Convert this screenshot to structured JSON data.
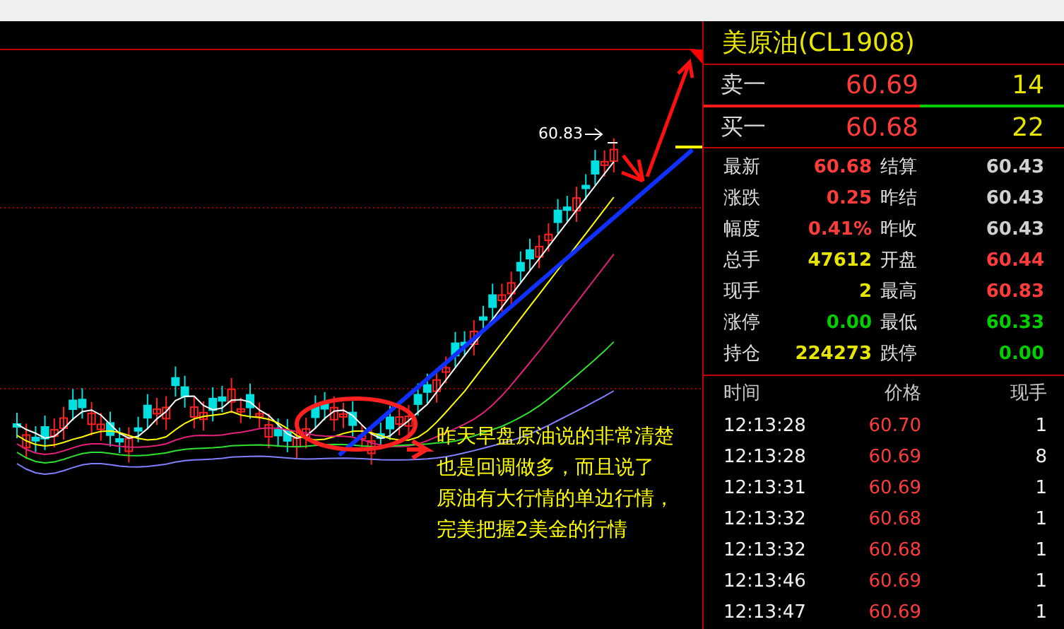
{
  "chart": {
    "high_label": "60.83",
    "annotation": [
      "昨天早盘原油说的非常清楚",
      "也是回调做多，而且说了",
      "原油有大行情的单边行情，",
      "完美把握2美金的行情"
    ]
  },
  "quote": {
    "title": "美原油(CL1908)",
    "book": [
      {
        "label": "卖一",
        "price": "60.69",
        "volume": "14"
      },
      {
        "label": "买一",
        "price": "60.68",
        "volume": "22"
      }
    ],
    "stats": [
      {
        "cells": [
          {
            "label": "最新",
            "value": "60.68",
            "color": "#ff3c3c"
          },
          {
            "label": "结算",
            "value": "60.43",
            "color": "#d0d0d0"
          }
        ]
      },
      {
        "cells": [
          {
            "label": "涨跌",
            "value": "0.25",
            "color": "#ff3c3c"
          },
          {
            "label": "昨结",
            "value": "60.43",
            "color": "#d0d0d0"
          }
        ]
      },
      {
        "cells": [
          {
            "label": "幅度",
            "value": "0.41%",
            "color": "#ff3c3c"
          },
          {
            "label": "昨收",
            "value": "60.43",
            "color": "#d0d0d0"
          }
        ]
      },
      {
        "cells": [
          {
            "label": "总手",
            "value": "47612",
            "color": "#e6e600"
          },
          {
            "label": "开盘",
            "value": "60.44",
            "color": "#ff3c3c"
          }
        ]
      },
      {
        "cells": [
          {
            "label": "现手",
            "value": "2",
            "color": "#e6e600"
          },
          {
            "label": "最高",
            "value": "60.83",
            "color": "#ff3c3c"
          }
        ]
      },
      {
        "cells": [
          {
            "label": "涨停",
            "value": "0.00",
            "color": "#00d000"
          },
          {
            "label": "最低",
            "value": "60.33",
            "color": "#00d000"
          }
        ]
      },
      {
        "cells": [
          {
            "label": "持仓",
            "value": "224273",
            "color": "#e6e600"
          },
          {
            "label": "跌停",
            "value": "0.00",
            "color": "#00d000"
          }
        ]
      }
    ]
  },
  "ticks": {
    "columns": [
      "时间",
      "价格",
      "现手"
    ],
    "rows": [
      {
        "time": "12:13:28",
        "price": "60.70",
        "volume": "1"
      },
      {
        "time": "12:13:28",
        "price": "60.69",
        "volume": "8"
      },
      {
        "time": "12:13:31",
        "price": "60.69",
        "volume": "1"
      },
      {
        "time": "12:13:32",
        "price": "60.68",
        "volume": "1"
      },
      {
        "time": "12:13:32",
        "price": "60.68",
        "volume": "1"
      },
      {
        "time": "12:13:46",
        "price": "60.69",
        "volume": "1"
      },
      {
        "time": "12:13:47",
        "price": "60.69",
        "volume": "1"
      }
    ]
  }
}
